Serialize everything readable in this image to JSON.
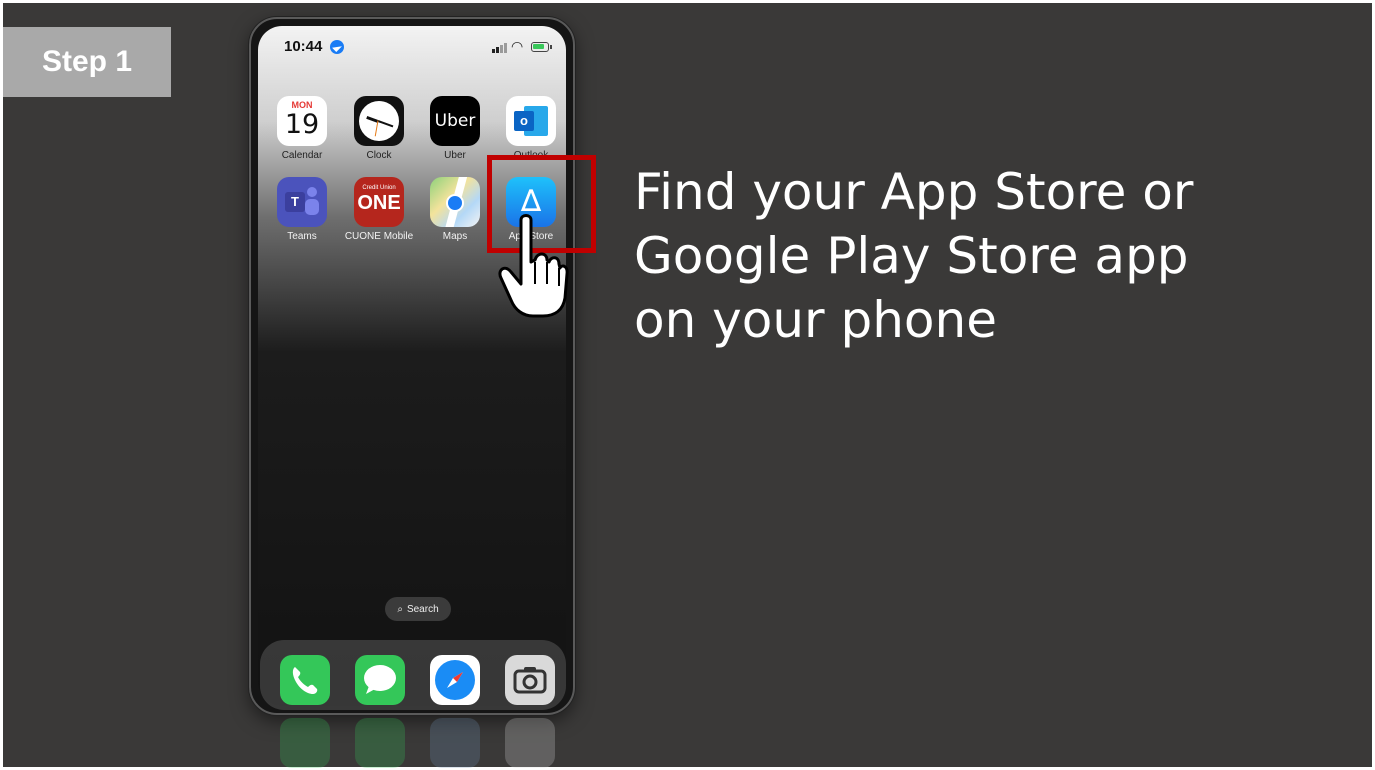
{
  "step": {
    "label": "Step 1"
  },
  "instruction": {
    "lines": [
      "Find your App Store or",
      "Google Play Store app",
      "on your phone"
    ]
  },
  "phone": {
    "status": {
      "time": "10:44",
      "icons": [
        "location-icon",
        "signal-icon",
        "wifi-icon",
        "battery-icon"
      ]
    },
    "apps": [
      {
        "label": "Calendar",
        "icon": "calendar-icon",
        "day": "MON",
        "date": "19"
      },
      {
        "label": "Clock",
        "icon": "clock-icon"
      },
      {
        "label": "Uber",
        "icon": "uber-icon",
        "text": "Uber"
      },
      {
        "label": "Outlook",
        "icon": "outlook-icon",
        "text": "o"
      },
      {
        "label": "Teams",
        "icon": "teams-icon",
        "text": "T"
      },
      {
        "label": "CUONE Mobile",
        "icon": "cuone-icon",
        "small": "Credit Union",
        "big": "ONE"
      },
      {
        "label": "Maps",
        "icon": "maps-icon"
      },
      {
        "label": "App Store",
        "icon": "app-store-icon"
      }
    ],
    "search": {
      "label": "Search"
    },
    "dock": [
      "phone-icon",
      "messages-icon",
      "safari-icon",
      "camera-icon"
    ]
  },
  "colors": {
    "background": "#3a3938",
    "step_badge": "#a9a9a9",
    "highlight": "#c00000"
  }
}
